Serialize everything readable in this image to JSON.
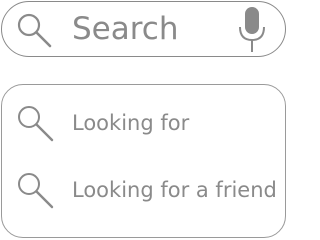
{
  "search": {
    "placeholder": "Search",
    "icon": "search-icon",
    "mic_icon": "microphone-icon"
  },
  "suggestions": [
    {
      "label": "Looking for",
      "icon": "search-icon"
    },
    {
      "label": "Looking for a friend",
      "icon": "search-icon"
    }
  ],
  "colors": {
    "stroke": "#8a8a8a",
    "text": "#8a8a8a",
    "background": "#ffffff"
  }
}
